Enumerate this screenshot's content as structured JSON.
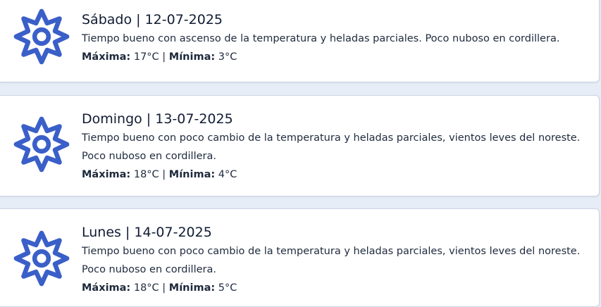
{
  "accent_color": "#3a5fc8",
  "forecasts": [
    {
      "icon": "gear-icon",
      "title": "Sábado | 12-07-2025",
      "description": "Tiempo bueno con ascenso de la temperatura y heladas parciales. Poco nuboso en cordillera.",
      "max_label": "Máxima:",
      "max_value": "17°C",
      "separator": "|",
      "min_label": "Mínima:",
      "min_value": "3°C"
    },
    {
      "icon": "gear-icon",
      "title": "Domingo | 13-07-2025",
      "description": "Tiempo bueno con poco cambio de la temperatura y heladas parciales, vientos leves del noreste. Poco nuboso en cordillera.",
      "max_label": "Máxima:",
      "max_value": "18°C",
      "separator": "|",
      "min_label": "Mínima:",
      "min_value": "4°C"
    },
    {
      "icon": "gear-icon",
      "title": "Lunes | 14-07-2025",
      "description": "Tiempo bueno con poco cambio de la temperatura y heladas parciales, vientos leves del noreste. Poco nuboso en cordillera.",
      "max_label": "Máxima:",
      "max_value": "18°C",
      "separator": "|",
      "min_label": "Mínima:",
      "min_value": "5°C"
    }
  ]
}
